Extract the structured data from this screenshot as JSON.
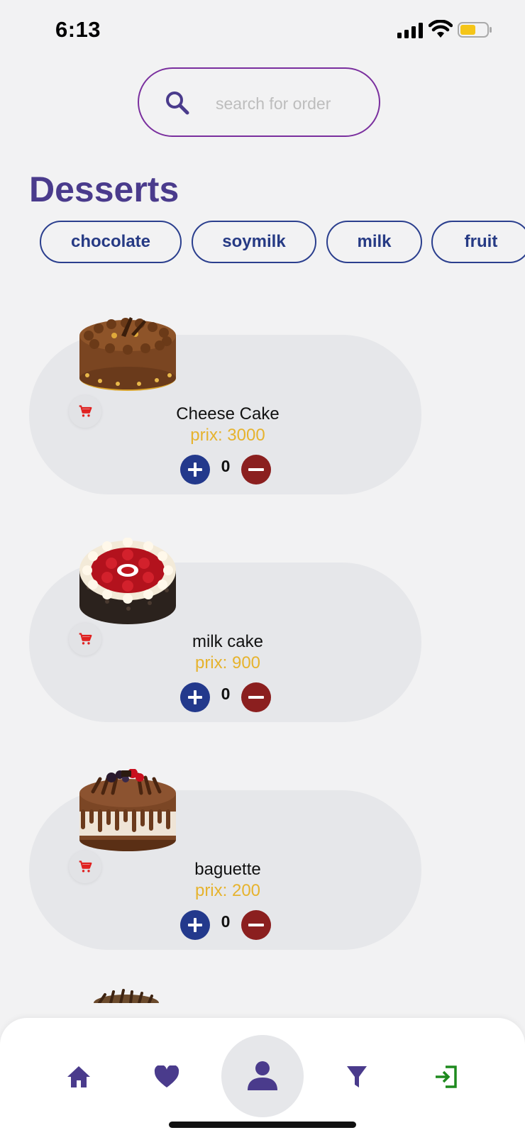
{
  "status_bar": {
    "time": "6:13"
  },
  "search": {
    "placeholder": "search for order"
  },
  "section": {
    "title": "Desserts"
  },
  "categories": [
    {
      "label": "chocolate"
    },
    {
      "label": "soymilk"
    },
    {
      "label": "milk"
    },
    {
      "label": "fruit"
    }
  ],
  "products": [
    {
      "name": "Cheese Cake",
      "price": "prix: 3000",
      "quantity": "0",
      "image": "chocolate-cake"
    },
    {
      "name": "milk cake",
      "price": "prix: 900",
      "quantity": "0",
      "image": "cherry-cake"
    },
    {
      "name": "baguette",
      "price": "prix: 200",
      "quantity": "0",
      "image": "drip-cake"
    }
  ],
  "nav": {
    "items": [
      {
        "icon": "home-icon"
      },
      {
        "icon": "heart-icon"
      },
      {
        "icon": "user-icon"
      },
      {
        "icon": "filter-icon"
      },
      {
        "icon": "login-icon"
      }
    ]
  },
  "colors": {
    "title": "#4a3b8c",
    "chip_border": "#2b3f8e",
    "price": "#e6b32e",
    "plus": "#23398c",
    "minus": "#8b1f1f",
    "cart": "#e0201f",
    "login": "#1e8a1e"
  }
}
